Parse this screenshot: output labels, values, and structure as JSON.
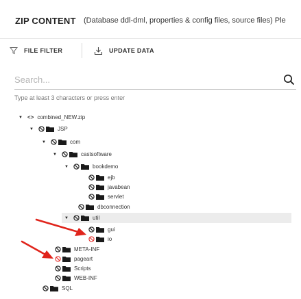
{
  "header": {
    "title": "ZIP CONTENT",
    "subtitle": "(Database ddl-dml, properties & config files, source files) Ple"
  },
  "toolbar": {
    "filter_label": "FILE FILTER",
    "update_label": "UPDATE DATA"
  },
  "search": {
    "placeholder": "Search...",
    "value": "",
    "hint": "Type at least 3 characters or press enter"
  },
  "tree": {
    "root": "combined_NEW.zip",
    "jsp": "JSP",
    "com": "com",
    "castsoftware": "castsoftware",
    "bookdemo": "bookdemo",
    "ejb": "ejb",
    "javabean": "javabean",
    "servlet": "servlet",
    "dbconnection": "dbconnection",
    "util": "util",
    "gui": "gui",
    "io": "io",
    "metainf": "META-INF",
    "pageart": "pageart",
    "scripts": "Scripts",
    "webinf": "WEB-INF",
    "sql": "SQL"
  },
  "colors": {
    "blocked_black": "#222222",
    "blocked_red": "#e53935",
    "arrow_red": "#e0241b",
    "selected_row": "#ececec"
  },
  "icons": {
    "filter": "filter-icon",
    "update": "download-icon",
    "search": "search-icon",
    "blocked": "blocked-icon",
    "folder": "folder-icon",
    "zip": "code-icon"
  }
}
